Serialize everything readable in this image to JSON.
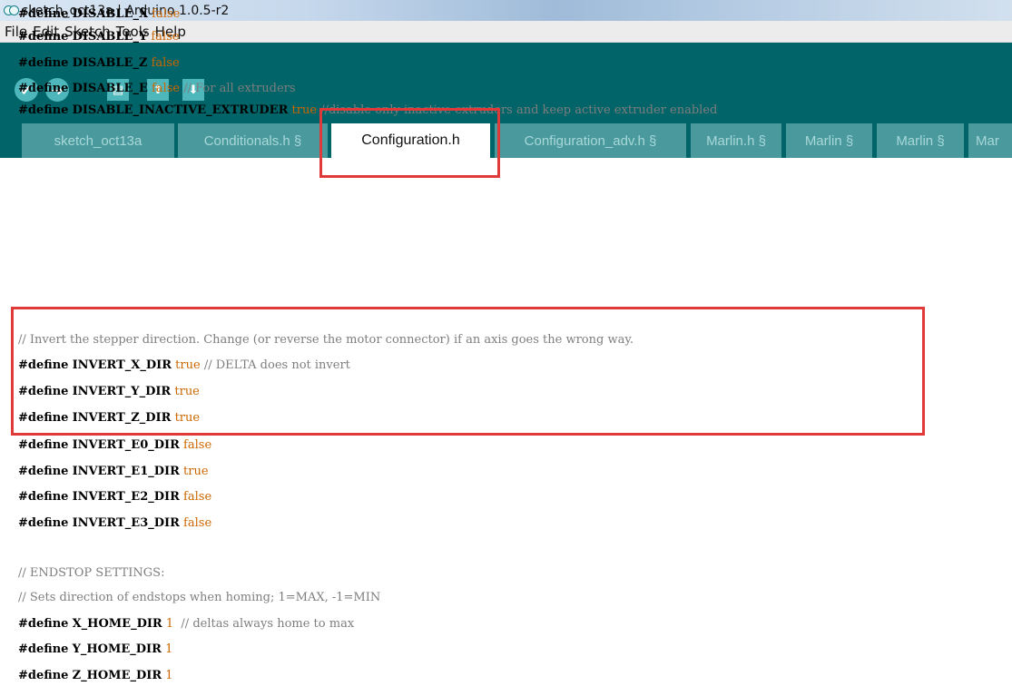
{
  "window": {
    "title": "sketch_oct13a | Arduino 1.0.5-r2"
  },
  "menu": [
    "File",
    "Edit",
    "Sketch",
    "Tools",
    "Help"
  ],
  "toolbar": {
    "verify_icon": "checkmark-icon",
    "upload_icon": "arrow-right-icon",
    "new_icon": "new-file-icon",
    "open_icon": "arrow-up-icon",
    "save_icon": "arrow-down-icon"
  },
  "tabs": [
    {
      "label": "sketch_oct13a",
      "active": false
    },
    {
      "label": "Conditionals.h §",
      "active": false
    },
    {
      "label": "Configuration.h",
      "active": true
    },
    {
      "label": "Configuration_adv.h §",
      "active": false
    },
    {
      "label": "Marlin.h §",
      "active": false
    },
    {
      "label": "Marlin §",
      "active": false
    },
    {
      "label": "Marlin §",
      "active": false
    },
    {
      "label": "Mar",
      "active": false
    }
  ],
  "code_lines": [
    {
      "kw": "#define",
      "name": "DISABLE_X",
      "val": "false",
      "comment": ""
    },
    {
      "kw": "#define",
      "name": "DISABLE_Y",
      "val": "false",
      "comment": ""
    },
    {
      "kw": "#define",
      "name": "DISABLE_Z",
      "val": "false",
      "comment": ""
    },
    {
      "kw": "#define",
      "name": "DISABLE_E",
      "val": "false",
      "comment": "// For all extruders"
    },
    {
      "kw": "#define",
      "name": "DISABLE_INACTIVE_EXTRUDER",
      "val": "true",
      "comment": "//disable only inactive extruders and keep active extruder enabled"
    },
    {
      "kw": "",
      "name": "",
      "val": "",
      "comment": ""
    },
    {
      "kw": "",
      "name": "",
      "val": "",
      "comment": "// Invert the stepper direction. Change (or reverse the motor connector) if an axis goes the wrong way."
    },
    {
      "kw": "#define",
      "name": "INVERT_X_DIR",
      "val": "true",
      "comment": "// DELTA does not invert"
    },
    {
      "kw": "#define",
      "name": "INVERT_Y_DIR",
      "val": "true",
      "comment": ""
    },
    {
      "kw": "#define",
      "name": "INVERT_Z_DIR",
      "val": "true",
      "comment": ""
    },
    {
      "kw": "#define",
      "name": "INVERT_E0_DIR",
      "val": "false",
      "comment": ""
    },
    {
      "kw": "#define",
      "name": "INVERT_E1_DIR",
      "val": "true",
      "comment": ""
    },
    {
      "kw": "#define",
      "name": "INVERT_E2_DIR",
      "val": "false",
      "comment": ""
    },
    {
      "kw": "#define",
      "name": "INVERT_E3_DIR",
      "val": "false",
      "comment": ""
    },
    {
      "kw": "",
      "name": "",
      "val": "",
      "comment": ""
    },
    {
      "kw": "",
      "name": "",
      "val": "",
      "comment": "// ENDSTOP SETTINGS:"
    },
    {
      "kw": "",
      "name": "",
      "val": "",
      "comment": "// Sets direction of endstops when homing; 1=MAX, -1=MIN"
    },
    {
      "kw": "#define",
      "name": "X_HOME_DIR",
      "val": "1",
      "comment": " // deltas always home to max"
    },
    {
      "kw": "#define",
      "name": "Y_HOME_DIR",
      "val": "1",
      "comment": ""
    },
    {
      "kw": "#define",
      "name": "Z_HOME_DIR",
      "val": "1",
      "comment": ""
    }
  ],
  "colors": {
    "toolbar_bg": "#006468",
    "button_bg": "#4db7bb",
    "inactive_tab_bg": "#4a9a9d",
    "literal": "#cc6600",
    "comment": "#7e7e7e",
    "highlight_border": "#e0393a"
  }
}
